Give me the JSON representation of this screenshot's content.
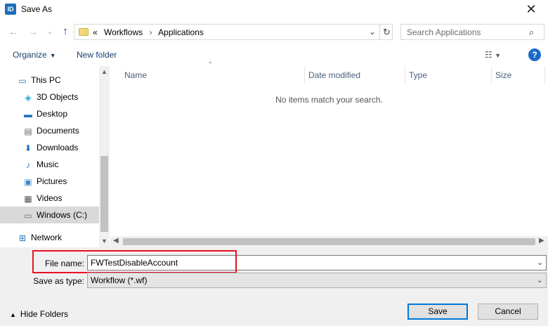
{
  "window": {
    "icon_text": "ID",
    "title": "Save As",
    "close_glyph": "✕"
  },
  "nav": {
    "back_glyph": "←",
    "forward_glyph": "→",
    "history_glyph": "⌄",
    "up_glyph": "↑",
    "address": {
      "overflow": "«",
      "crumbs": [
        "Workflows",
        "Applications"
      ],
      "separator": "›"
    },
    "search_placeholder": "Search Applications"
  },
  "toolbar": {
    "organize_label": "Organize",
    "new_folder_label": "New folder",
    "help_glyph": "?"
  },
  "sidebar": {
    "items": [
      {
        "label": "This PC",
        "icon": "computer-icon",
        "color": "#1e73be"
      },
      {
        "label": "3D Objects",
        "icon": "cube-icon",
        "color": "#27a9e1"
      },
      {
        "label": "Desktop",
        "icon": "desktop-icon",
        "color": "#1e73be"
      },
      {
        "label": "Documents",
        "icon": "document-icon",
        "color": "#6b6b6b"
      },
      {
        "label": "Downloads",
        "icon": "download-icon",
        "color": "#1e73be"
      },
      {
        "label": "Music",
        "icon": "music-icon",
        "color": "#1e73be"
      },
      {
        "label": "Pictures",
        "icon": "pictures-icon",
        "color": "#3a87c8"
      },
      {
        "label": "Videos",
        "icon": "video-icon",
        "color": "#555555"
      },
      {
        "label": "Windows (C:)",
        "icon": "drive-icon",
        "color": "#6b6b6b"
      },
      {
        "label": "Network",
        "icon": "network-icon",
        "color": "#1e73be"
      }
    ]
  },
  "filelist": {
    "columns": [
      "Name",
      "Date modified",
      "Type",
      "Size"
    ],
    "empty_message": "No items match your search."
  },
  "form": {
    "file_name_label": "File name:",
    "file_name_value": "FWTestDisableAccount",
    "save_as_type_label": "Save as type:",
    "save_as_type_value": "Workflow (*.wf)"
  },
  "buttons": {
    "save_label": "Save",
    "cancel_label": "Cancel",
    "hide_folders_label": "Hide Folders"
  },
  "colors": {
    "highlight_box": "#e81123",
    "primary_border": "#0078d7",
    "selection": "#d9d9d9"
  }
}
